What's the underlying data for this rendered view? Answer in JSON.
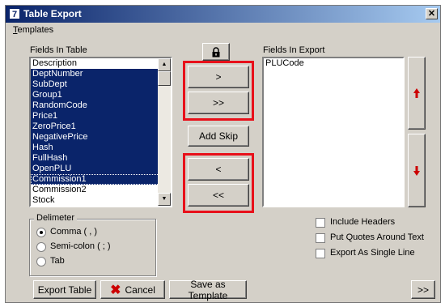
{
  "window": {
    "title": "Table Export",
    "close_glyph": "✕"
  },
  "menu": {
    "templates": "Templates"
  },
  "left": {
    "label": "Fields In Table",
    "items": [
      "Description",
      "DeptNumber",
      "SubDept",
      "Group1",
      "RandomCode",
      "Price1",
      "ZeroPrice1",
      "NegativePrice",
      "Hash",
      "FullHash",
      "OpenPLU",
      "Commission1",
      "Commission2",
      "Stock"
    ],
    "selected_from": 1,
    "selected_to": 11
  },
  "right": {
    "label": "Fields In Export",
    "items": [
      "PLUCode"
    ]
  },
  "buttons": {
    "add": ">",
    "add_all": ">>",
    "add_skip": "Add Skip",
    "remove": "<",
    "remove_all": "<<",
    "export_table": "Export Table",
    "cancel": "Cancel",
    "save_template": "Save as Template",
    "more": ">>"
  },
  "delimiter": {
    "title": "Delimeter",
    "options": [
      "Comma ( , )",
      "Semi-colon ( ; )",
      "Tab"
    ],
    "selected": 0
  },
  "options": {
    "include_headers": "Include Headers",
    "put_quotes": "Put Quotes Around Text",
    "single_line": "Export As Single Line"
  },
  "colors": {
    "highlight": "#e8101a",
    "selection": "#0a246a",
    "arrow_red": "#cc0000"
  }
}
